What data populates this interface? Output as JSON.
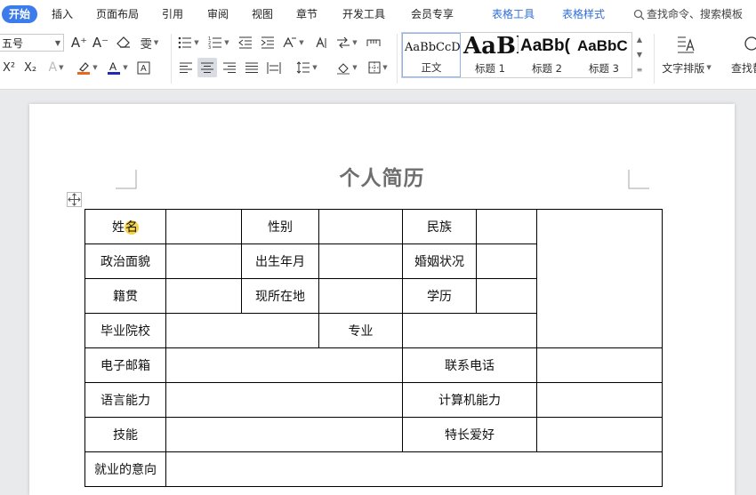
{
  "menu": {
    "tabs": [
      "开始",
      "插入",
      "页面布局",
      "引用",
      "审阅",
      "视图",
      "章节",
      "开发工具",
      "会员专享"
    ],
    "active_tab": "开始",
    "context_tabs": [
      "表格工具",
      "表格样式"
    ],
    "search_label": "查找命令、搜索模板"
  },
  "ribbon": {
    "font_size": "五号",
    "styles": [
      {
        "preview": "AaBbCcDd",
        "label": "正文"
      },
      {
        "preview": "AaBl",
        "label": "标题 1"
      },
      {
        "preview": "AaBb(",
        "label": "标题 2"
      },
      {
        "preview": "AaBbC",
        "label": "标题 3"
      }
    ],
    "text_layout_label": "文字排版",
    "find_label": "查找替"
  },
  "document": {
    "title": "个人简历",
    "rows": [
      [
        "姓名",
        "",
        "性别",
        "",
        "民族",
        ""
      ],
      [
        "政治面貌",
        "",
        "出生年月",
        "",
        "婚姻状况",
        ""
      ],
      [
        "籍贯",
        "",
        "现所在地",
        "",
        "学历",
        ""
      ],
      [
        "毕业院校",
        "",
        "专业",
        ""
      ],
      [
        "电子邮箱",
        "",
        "联系电话",
        ""
      ],
      [
        "语言能力",
        "",
        "计算机能力",
        ""
      ],
      [
        "技能",
        "",
        "特长爱好",
        ""
      ],
      [
        "就业的意向",
        ""
      ]
    ]
  },
  "colors": {
    "accent": "#3b7bea",
    "context_tab": "#2f6fd8",
    "highlight": "#f7d44a",
    "font_color": "#1f2bb5",
    "highlight_pen": "#e8691a"
  }
}
